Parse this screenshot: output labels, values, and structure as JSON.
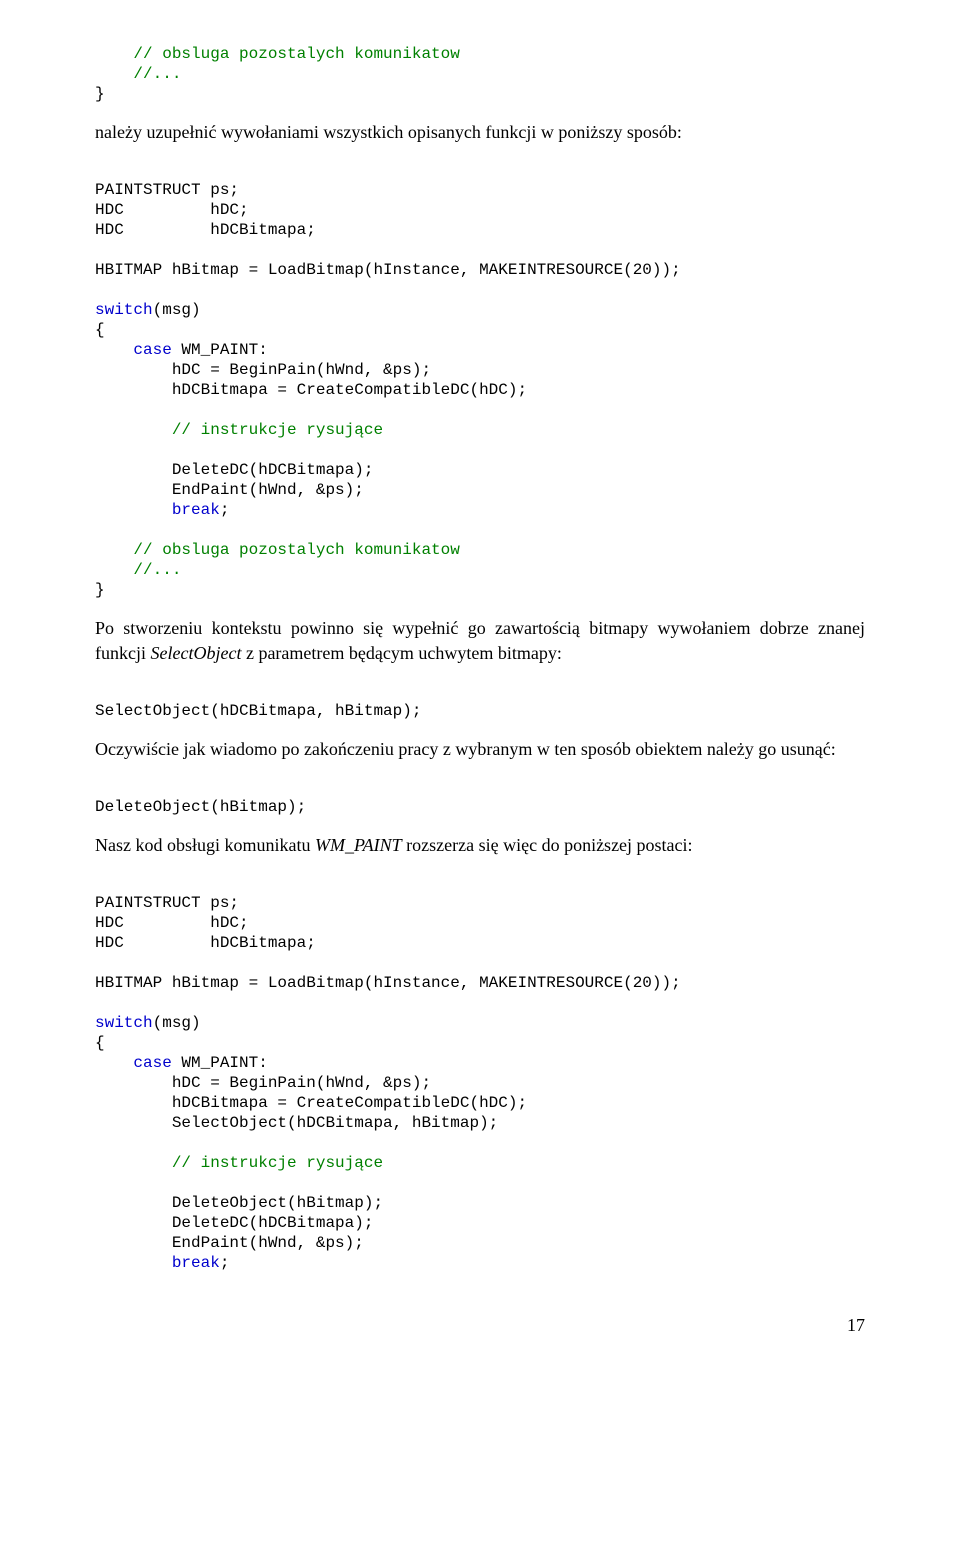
{
  "code1": {
    "l1": "    // obsluga pozostalych komunikatow",
    "l2": "    //...",
    "l3": "}"
  },
  "para1": "należy uzupełnić wywołaniami wszystkich opisanych funkcji w poniższy sposób:",
  "code2": {
    "l1": "PAINTSTRUCT ps;",
    "l2": "HDC         hDC;",
    "l3": "HDC         hDCBitmapa;",
    "l4": "",
    "l5": "HBITMAP hBitmap = LoadBitmap(hInstance, MAKEINTRESOURCE(20));",
    "l6": "",
    "l7a": "switch",
    "l7b": "(msg)",
    "l8": "{",
    "l9a": "    case",
    "l9b": " WM_PAINT:",
    "l10": "        hDC = BeginPain(hWnd, &ps);",
    "l11": "        hDCBitmapa = CreateCompatibleDC(hDC);",
    "l12": "",
    "l13": "        // instrukcje rysujące",
    "l14": "",
    "l15": "        DeleteDC(hDCBitmapa);",
    "l16": "        EndPaint(hWnd, &ps);",
    "l17a": "        break",
    "l17b": ";",
    "l18": "",
    "l19": "    // obsluga pozostalych komunikatow",
    "l20": "    //...",
    "l21": "}"
  },
  "para2a": "Po stworzeniu kontekstu powinno się wypełnić go zawartością bitmapy wywołaniem dobrze znanej funkcji ",
  "para2b": "SelectObject",
  "para2c": " z parametrem będącym uchwytem bitmapy:",
  "code3": {
    "l1": "SelectObject(hDCBitmapa, hBitmap);"
  },
  "para3": "Oczywiście jak wiadomo po zakończeniu pracy z wybranym w ten sposób obiektem należy go usunąć:",
  "code4": {
    "l1": "DeleteObject(hBitmap);"
  },
  "para4a": "Nasz kod obsługi komunikatu ",
  "para4b": "WM_PAINT",
  "para4c": " rozszerza się więc do poniższej postaci:",
  "code5": {
    "l1": "PAINTSTRUCT ps;",
    "l2": "HDC         hDC;",
    "l3": "HDC         hDCBitmapa;",
    "l4": "",
    "l5": "HBITMAP hBitmap = LoadBitmap(hInstance, MAKEINTRESOURCE(20));",
    "l6": "",
    "l7a": "switch",
    "l7b": "(msg)",
    "l8": "{",
    "l9a": "    case",
    "l9b": " WM_PAINT:",
    "l10": "        hDC = BeginPain(hWnd, &ps);",
    "l11": "        hDCBitmapa = CreateCompatibleDC(hDC);",
    "l12": "        SelectObject(hDCBitmapa, hBitmap);",
    "l13": "",
    "l14": "        // instrukcje rysujące",
    "l15": "",
    "l16": "        DeleteObject(hBitmap);",
    "l17": "        DeleteDC(hDCBitmapa);",
    "l18": "        EndPaint(hWnd, &ps);",
    "l19a": "        break",
    "l19b": ";"
  },
  "pagenum": "17"
}
